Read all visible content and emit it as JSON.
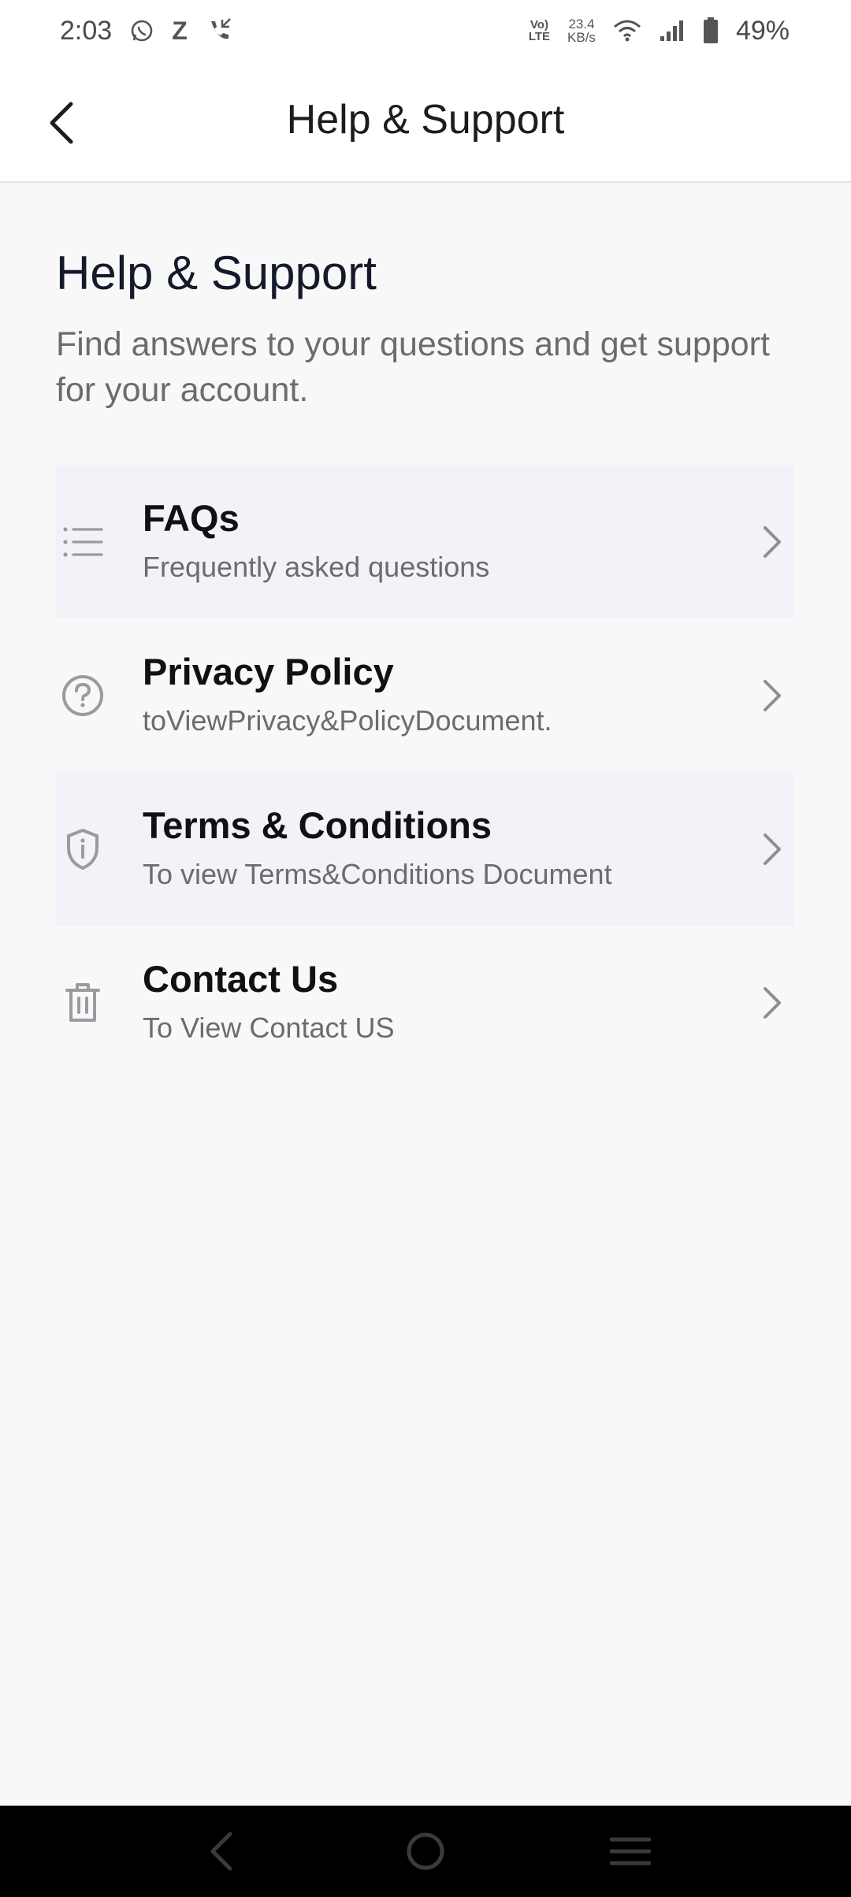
{
  "status_bar": {
    "time": "2:03",
    "volte_top": "Vo)",
    "volte_bottom": "LTE",
    "speed_value": "23.4",
    "speed_unit": "KB/s",
    "battery_percent": "49%",
    "z_app": "Z"
  },
  "app_bar": {
    "title": "Help & Support"
  },
  "page": {
    "title": "Help & Support",
    "subtitle": "Find answers to your questions and get support for your account."
  },
  "menu": [
    {
      "label": "FAQs",
      "description": "Frequently asked questions",
      "icon": "list-icon"
    },
    {
      "label": "Privacy Policy",
      "description": "toViewPrivacy&PolicyDocument.",
      "icon": "question-circle-icon"
    },
    {
      "label": "Terms & Conditions",
      "description": "To view Terms&Conditions Document",
      "icon": "shield-info-icon"
    },
    {
      "label": "Contact Us",
      "description": "To View Contact US",
      "icon": "trash-icon"
    }
  ],
  "colors": {
    "background": "#f8f8f9",
    "shaded_row": "#f1f3f8",
    "icon_gray": "#8e8e93",
    "title_text": "#141a2a"
  }
}
